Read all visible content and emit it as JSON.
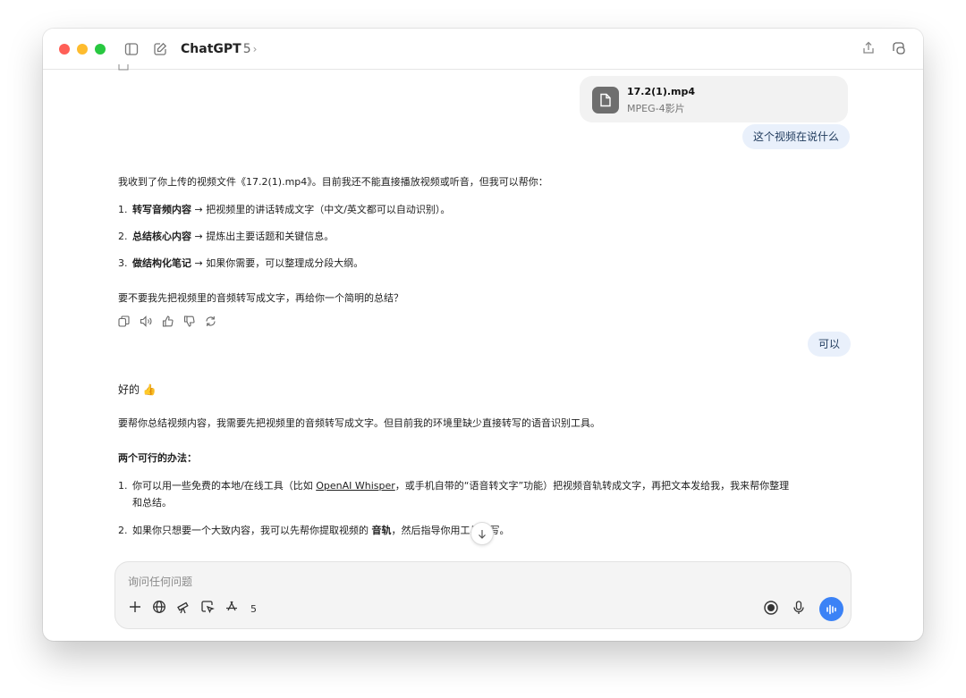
{
  "window": {
    "title": "ChatGPT",
    "model": "5",
    "chevron": "›"
  },
  "attachment": {
    "name": "17.2(1).mp4",
    "type": "MPEG-4影片"
  },
  "user_msg_1": "这个视频在说什么",
  "assistant_1": {
    "intro": "我收到了你上传的视频文件《17.2(1).mp4》。目前我还不能直接播放视频或听音，但我可以帮你：",
    "items": [
      {
        "num": "1.",
        "bold": "转写音频内容",
        "rest": " → 把视频里的讲话转成文字（中文/英文都可以自动识别）。"
      },
      {
        "num": "2.",
        "bold": "总结核心内容",
        "rest": " → 提炼出主要话题和关键信息。"
      },
      {
        "num": "3.",
        "bold": "做结构化笔记",
        "rest": " → 如果你需要，可以整理成分段大纲。"
      }
    ],
    "question": "要不要我先把视频里的音频转写成文字，再给你一个简明的总结？"
  },
  "user_msg_2": "可以",
  "assistant_2": {
    "greeting": "好的 👍",
    "line1": "要帮你总结视频内容，我需要先把视频里的音频转写成文字。但目前我的环境里缺少直接转写的语音识别工具。",
    "heading": "两个可行的办法：",
    "opt1_num": "1.",
    "opt1_a": "你可以用一些免费的本地/在线工具（比如 ",
    "opt1_link": "OpenAI Whisper",
    "opt1_b": "，或手机自带的“语音转文字”功能）把视频音轨转成文字，再把文本发给我，我来帮你整理",
    "opt1_c": "和总结。",
    "opt2_num": "2.",
    "opt2_a": "如果你只想要一个大致内容，我可以先帮你提取视频的 ",
    "opt2_bold": "音轨",
    "opt2_b": "，然后指导你用工具转写。"
  },
  "composer": {
    "placeholder": "询问任何问题",
    "tool_count": "5"
  },
  "colors": {
    "accent": "#3b82f6",
    "user_bubble": "#e9f0fb"
  }
}
